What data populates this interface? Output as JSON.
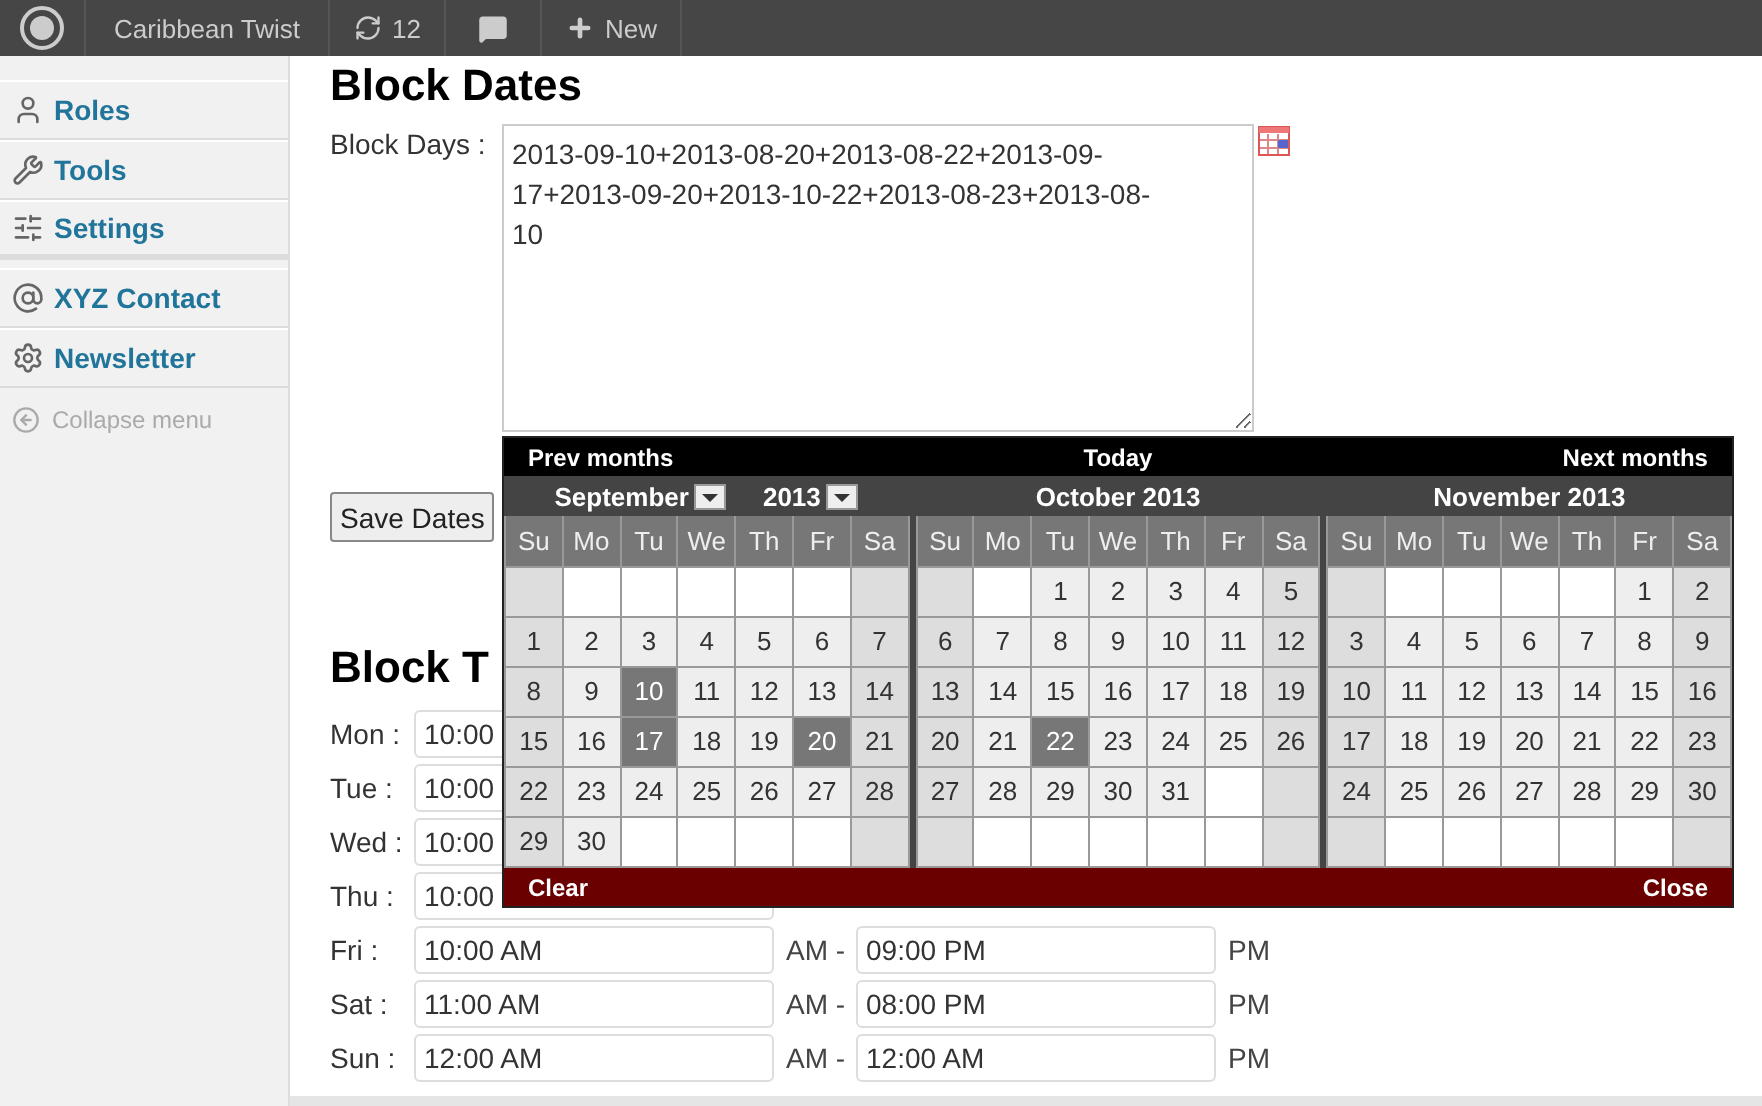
{
  "topbar": {
    "site": "Caribbean Twist",
    "updates": "12",
    "new": "New"
  },
  "sidebar": {
    "items": [
      {
        "label": "Roles",
        "separator_after": false
      },
      {
        "label": "Tools",
        "separator_after": false
      },
      {
        "label": "Settings",
        "separator_after": true
      },
      {
        "label": "XYZ Contact",
        "separator_after": false
      },
      {
        "label": "Newsletter",
        "separator_after": false
      }
    ],
    "collapse": "Collapse menu"
  },
  "block_dates": {
    "title": "Block Dates",
    "label": "Block Days :",
    "value": "2013-09-10+2013-08-20+2013-08-22+2013-09-17+2013-09-20+2013-10-22+2013-08-23+2013-08-10",
    "save": "Save Dates"
  },
  "block_times": {
    "title": "Block T",
    "rows": [
      {
        "day": "Mon :",
        "start": "10:00"
      },
      {
        "day": "Tue :",
        "start": "10:00"
      },
      {
        "day": "Wed :",
        "start": "10:00"
      },
      {
        "day": "Thu :",
        "start": "10:00"
      },
      {
        "day": "Fri :",
        "start": "10:00 AM",
        "start_suffix": "AM -",
        "end": "09:00 PM",
        "end_suffix": "PM"
      },
      {
        "day": "Sat :",
        "start": "11:00 AM",
        "start_suffix": "AM -",
        "end": "08:00 PM",
        "end_suffix": "PM"
      },
      {
        "day": "Sun :",
        "start": "12:00 AM",
        "start_suffix": "AM -",
        "end": "12:00 AM",
        "end_suffix": "PM"
      }
    ]
  },
  "datepicker": {
    "prev": "Prev months",
    "today": "Today",
    "next": "Next months",
    "clear": "Clear",
    "close": "Close",
    "months": [
      {
        "kind": "select",
        "month": "September",
        "year": "2013",
        "weekdays": [
          "Su",
          "Mo",
          "Tu",
          "We",
          "Th",
          "Fr",
          "Sa"
        ],
        "weeks": [
          [
            {
              "kind": "blank"
            },
            {
              "kind": "blank"
            },
            {
              "kind": "blank"
            },
            {
              "kind": "blank"
            },
            {
              "kind": "blank"
            },
            {
              "kind": "blank"
            },
            {
              "kind": "blank"
            }
          ],
          [
            {
              "kind": "day",
              "day": "1",
              "blocked": false
            },
            {
              "kind": "day",
              "day": "2",
              "blocked": false
            },
            {
              "kind": "day",
              "day": "3",
              "blocked": false
            },
            {
              "kind": "day",
              "day": "4",
              "blocked": false
            },
            {
              "kind": "day",
              "day": "5",
              "blocked": false
            },
            {
              "kind": "day",
              "day": "6",
              "blocked": false
            },
            {
              "kind": "day",
              "day": "7",
              "blocked": false
            }
          ],
          [
            {
              "kind": "day",
              "day": "8",
              "blocked": false
            },
            {
              "kind": "day",
              "day": "9",
              "blocked": false
            },
            {
              "kind": "day",
              "day": "10",
              "blocked": true
            },
            {
              "kind": "day",
              "day": "11",
              "blocked": false
            },
            {
              "kind": "day",
              "day": "12",
              "blocked": false
            },
            {
              "kind": "day",
              "day": "13",
              "blocked": false
            },
            {
              "kind": "day",
              "day": "14",
              "blocked": false
            }
          ],
          [
            {
              "kind": "day",
              "day": "15",
              "blocked": false
            },
            {
              "kind": "day",
              "day": "16",
              "blocked": false
            },
            {
              "kind": "day",
              "day": "17",
              "blocked": true
            },
            {
              "kind": "day",
              "day": "18",
              "blocked": false
            },
            {
              "kind": "day",
              "day": "19",
              "blocked": false
            },
            {
              "kind": "day",
              "day": "20",
              "blocked": true
            },
            {
              "kind": "day",
              "day": "21",
              "blocked": false
            }
          ],
          [
            {
              "kind": "day",
              "day": "22",
              "blocked": false
            },
            {
              "kind": "day",
              "day": "23",
              "blocked": false
            },
            {
              "kind": "day",
              "day": "24",
              "blocked": false
            },
            {
              "kind": "day",
              "day": "25",
              "blocked": false
            },
            {
              "kind": "day",
              "day": "26",
              "blocked": false
            },
            {
              "kind": "day",
              "day": "27",
              "blocked": false
            },
            {
              "kind": "day",
              "day": "28",
              "blocked": false
            }
          ],
          [
            {
              "kind": "day",
              "day": "29",
              "blocked": false
            },
            {
              "kind": "day",
              "day": "30",
              "blocked": false
            },
            {
              "kind": "blank"
            },
            {
              "kind": "blank"
            },
            {
              "kind": "blank"
            },
            {
              "kind": "blank"
            },
            {
              "kind": "blank"
            }
          ]
        ]
      },
      {
        "kind": "title",
        "title": "October 2013",
        "weekdays": [
          "Su",
          "Mo",
          "Tu",
          "We",
          "Th",
          "Fr",
          "Sa"
        ],
        "weeks": [
          [
            {
              "kind": "blank"
            },
            {
              "kind": "blank"
            },
            {
              "kind": "day",
              "day": "1",
              "blocked": false
            },
            {
              "kind": "day",
              "day": "2",
              "blocked": false
            },
            {
              "kind": "day",
              "day": "3",
              "blocked": false
            },
            {
              "kind": "day",
              "day": "4",
              "blocked": false
            },
            {
              "kind": "day",
              "day": "5",
              "blocked": false
            }
          ],
          [
            {
              "kind": "day",
              "day": "6",
              "blocked": false
            },
            {
              "kind": "day",
              "day": "7",
              "blocked": false
            },
            {
              "kind": "day",
              "day": "8",
              "blocked": false
            },
            {
              "kind": "day",
              "day": "9",
              "blocked": false
            },
            {
              "kind": "day",
              "day": "10",
              "blocked": false
            },
            {
              "kind": "day",
              "day": "11",
              "blocked": false
            },
            {
              "kind": "day",
              "day": "12",
              "blocked": false
            }
          ],
          [
            {
              "kind": "day",
              "day": "13",
              "blocked": false
            },
            {
              "kind": "day",
              "day": "14",
              "blocked": false
            },
            {
              "kind": "day",
              "day": "15",
              "blocked": false
            },
            {
              "kind": "day",
              "day": "16",
              "blocked": false
            },
            {
              "kind": "day",
              "day": "17",
              "blocked": false
            },
            {
              "kind": "day",
              "day": "18",
              "blocked": false
            },
            {
              "kind": "day",
              "day": "19",
              "blocked": false
            }
          ],
          [
            {
              "kind": "day",
              "day": "20",
              "blocked": false
            },
            {
              "kind": "day",
              "day": "21",
              "blocked": false
            },
            {
              "kind": "day",
              "day": "22",
              "blocked": true
            },
            {
              "kind": "day",
              "day": "23",
              "blocked": false
            },
            {
              "kind": "day",
              "day": "24",
              "blocked": false
            },
            {
              "kind": "day",
              "day": "25",
              "blocked": false
            },
            {
              "kind": "day",
              "day": "26",
              "blocked": false
            }
          ],
          [
            {
              "kind": "day",
              "day": "27",
              "blocked": false
            },
            {
              "kind": "day",
              "day": "28",
              "blocked": false
            },
            {
              "kind": "day",
              "day": "29",
              "blocked": false
            },
            {
              "kind": "day",
              "day": "30",
              "blocked": false
            },
            {
              "kind": "day",
              "day": "31",
              "blocked": false
            },
            {
              "kind": "blank"
            },
            {
              "kind": "blank"
            }
          ],
          [
            {
              "kind": "blank"
            },
            {
              "kind": "blank"
            },
            {
              "kind": "blank"
            },
            {
              "kind": "blank"
            },
            {
              "kind": "blank"
            },
            {
              "kind": "blank"
            },
            {
              "kind": "blank"
            }
          ]
        ]
      },
      {
        "kind": "title",
        "title": "November 2013",
        "weekdays": [
          "Su",
          "Mo",
          "Tu",
          "We",
          "Th",
          "Fr",
          "Sa"
        ],
        "weeks": [
          [
            {
              "kind": "blank"
            },
            {
              "kind": "blank"
            },
            {
              "kind": "blank"
            },
            {
              "kind": "blank"
            },
            {
              "kind": "blank"
            },
            {
              "kind": "day",
              "day": "1",
              "blocked": false
            },
            {
              "kind": "day",
              "day": "2",
              "blocked": false
            }
          ],
          [
            {
              "kind": "day",
              "day": "3",
              "blocked": false
            },
            {
              "kind": "day",
              "day": "4",
              "blocked": false
            },
            {
              "kind": "day",
              "day": "5",
              "blocked": false
            },
            {
              "kind": "day",
              "day": "6",
              "blocked": false
            },
            {
              "kind": "day",
              "day": "7",
              "blocked": false
            },
            {
              "kind": "day",
              "day": "8",
              "blocked": false
            },
            {
              "kind": "day",
              "day": "9",
              "blocked": false
            }
          ],
          [
            {
              "kind": "day",
              "day": "10",
              "blocked": false
            },
            {
              "kind": "day",
              "day": "11",
              "blocked": false
            },
            {
              "kind": "day",
              "day": "12",
              "blocked": false
            },
            {
              "kind": "day",
              "day": "13",
              "blocked": false
            },
            {
              "kind": "day",
              "day": "14",
              "blocked": false
            },
            {
              "kind": "day",
              "day": "15",
              "blocked": false
            },
            {
              "kind": "day",
              "day": "16",
              "blocked": false
            }
          ],
          [
            {
              "kind": "day",
              "day": "17",
              "blocked": false
            },
            {
              "kind": "day",
              "day": "18",
              "blocked": false
            },
            {
              "kind": "day",
              "day": "19",
              "blocked": false
            },
            {
              "kind": "day",
              "day": "20",
              "blocked": false
            },
            {
              "kind": "day",
              "day": "21",
              "blocked": false
            },
            {
              "kind": "day",
              "day": "22",
              "blocked": false
            },
            {
              "kind": "day",
              "day": "23",
              "blocked": false
            }
          ],
          [
            {
              "kind": "day",
              "day": "24",
              "blocked": false
            },
            {
              "kind": "day",
              "day": "25",
              "blocked": false
            },
            {
              "kind": "day",
              "day": "26",
              "blocked": false
            },
            {
              "kind": "day",
              "day": "27",
              "blocked": false
            },
            {
              "kind": "day",
              "day": "28",
              "blocked": false
            },
            {
              "kind": "day",
              "day": "29",
              "blocked": false
            },
            {
              "kind": "day",
              "day": "30",
              "blocked": false
            }
          ],
          [
            {
              "kind": "blank"
            },
            {
              "kind": "blank"
            },
            {
              "kind": "blank"
            },
            {
              "kind": "blank"
            },
            {
              "kind": "blank"
            },
            {
              "kind": "blank"
            },
            {
              "kind": "blank"
            }
          ]
        ]
      }
    ]
  }
}
